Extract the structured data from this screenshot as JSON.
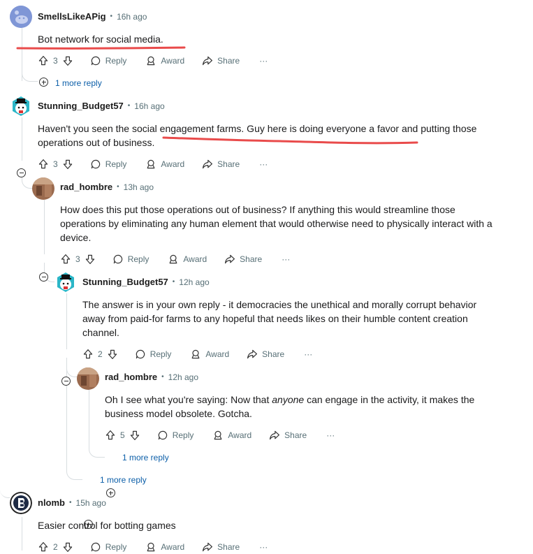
{
  "comments": [
    {
      "author": "SmellsLikeAPig",
      "time": "16h ago",
      "text": "Bot network for social media.",
      "score": "3"
    },
    {
      "author": "Stunning_Budget57",
      "time": "16h ago",
      "text": "Haven't you seen the social engagement farms. Guy here is doing everyone a favor and putting those operations out of business.",
      "score": "3"
    },
    {
      "author": "rad_hombre",
      "time": "13h ago",
      "text": "How does this put those operations out of business? If anything this would streamline those operations by eliminating any human element that would otherwise need to physically interact with a device.",
      "score": "3"
    },
    {
      "author": "Stunning_Budget57",
      "time": "12h ago",
      "text": "The answer is in your own reply - it democracies the unethical and morally corrupt behavior away from paid-for farms to any hopeful that needs likes on their humble content creation channel.",
      "score": "2"
    },
    {
      "author": "rad_hombre",
      "time": "12h ago",
      "text_before": "Oh I see what you're saying: Now that ",
      "text_em": "anyone",
      "text_after": " can engage in the activity, it makes the business model obsolete. Gotcha.",
      "score": "5"
    },
    {
      "author": "nlomb",
      "time": "15h ago",
      "text": "Easier control for botting games",
      "score": "2"
    }
  ],
  "labels": {
    "reply": "Reply",
    "award": "Award",
    "share": "Share",
    "more": "···",
    "separator": "•"
  },
  "more_replies": [
    "1 more reply",
    "1 more reply",
    "1 more reply"
  ],
  "colors": {
    "annotation": "#e94b4b",
    "link": "#0b5ea8",
    "meta": "#576f76",
    "thread_line": "#d8dde0"
  },
  "icons": [
    "upvote-icon",
    "downvote-icon",
    "comment-icon",
    "award-icon",
    "share-icon",
    "collapse-icon",
    "expand-icon"
  ]
}
